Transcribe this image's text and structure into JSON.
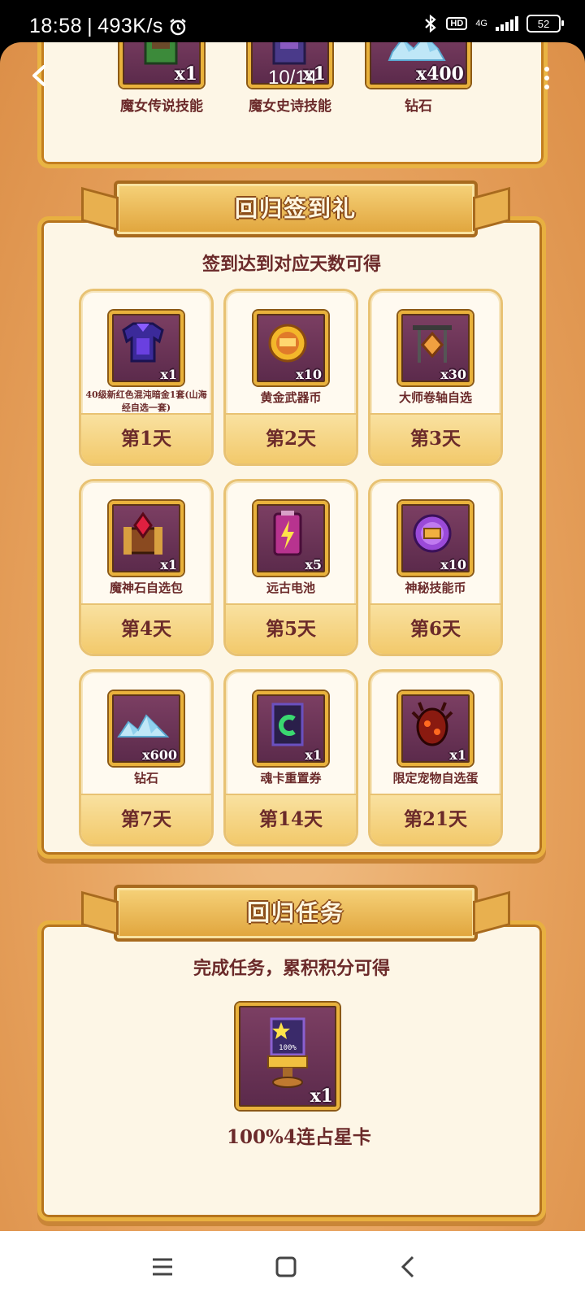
{
  "status_bar": {
    "time": "18:58",
    "network_speed": "493K/s",
    "hd_label": "HD",
    "network_type": "4G",
    "battery": "52"
  },
  "top_bar": {
    "page_counter": "10/14"
  },
  "top_rewards": [
    {
      "name": "魔女传说技能",
      "qty": "x1",
      "icon": "book-icon"
    },
    {
      "name": "魔女史诗技能",
      "qty": "x1",
      "icon": "book-icon"
    },
    {
      "name": "钻石",
      "qty": "x400",
      "icon": "diamond-pile-icon"
    }
  ],
  "checkin": {
    "title": "回归签到礼",
    "subtitle": "签到达到对应天数可得",
    "rewards": [
      {
        "name": "40级新红色混沌暗金1套(山海经自选一套)",
        "qty": "x1",
        "day": "第1天",
        "icon": "armor-icon"
      },
      {
        "name": "黄金武器币",
        "qty": "x10",
        "day": "第2天",
        "icon": "gold-coin-icon"
      },
      {
        "name": "大师卷轴自选",
        "qty": "x30",
        "day": "第3天",
        "icon": "scroll-icon"
      },
      {
        "name": "魔神石自选包",
        "qty": "x1",
        "day": "第4天",
        "icon": "gem-chest-icon"
      },
      {
        "name": "远古电池",
        "qty": "x5",
        "day": "第5天",
        "icon": "battery-icon"
      },
      {
        "name": "神秘技能币",
        "qty": "x10",
        "day": "第6天",
        "icon": "skill-coin-icon"
      },
      {
        "name": "钻石",
        "qty": "x600",
        "day": "第7天",
        "icon": "diamond-pile-icon"
      },
      {
        "name": "魂卡重置券",
        "qty": "x1",
        "day": "第14天",
        "icon": "reset-card-icon"
      },
      {
        "name": "限定宠物自选蛋",
        "qty": "x1",
        "day": "第21天",
        "icon": "pet-egg-icon"
      }
    ]
  },
  "missions": {
    "title": "回归任务",
    "subtitle": "完成任务，累积积分可得",
    "reward": {
      "name": "100%4连占星卡",
      "qty": "x1",
      "icon": "star-card-icon",
      "card_text": "100%"
    }
  },
  "colors": {
    "gold_border": "#e8b040",
    "panel_bg": "#fdf6e6",
    "text_maroon": "#6b2a2a",
    "icon_bg": "#6a3356"
  }
}
